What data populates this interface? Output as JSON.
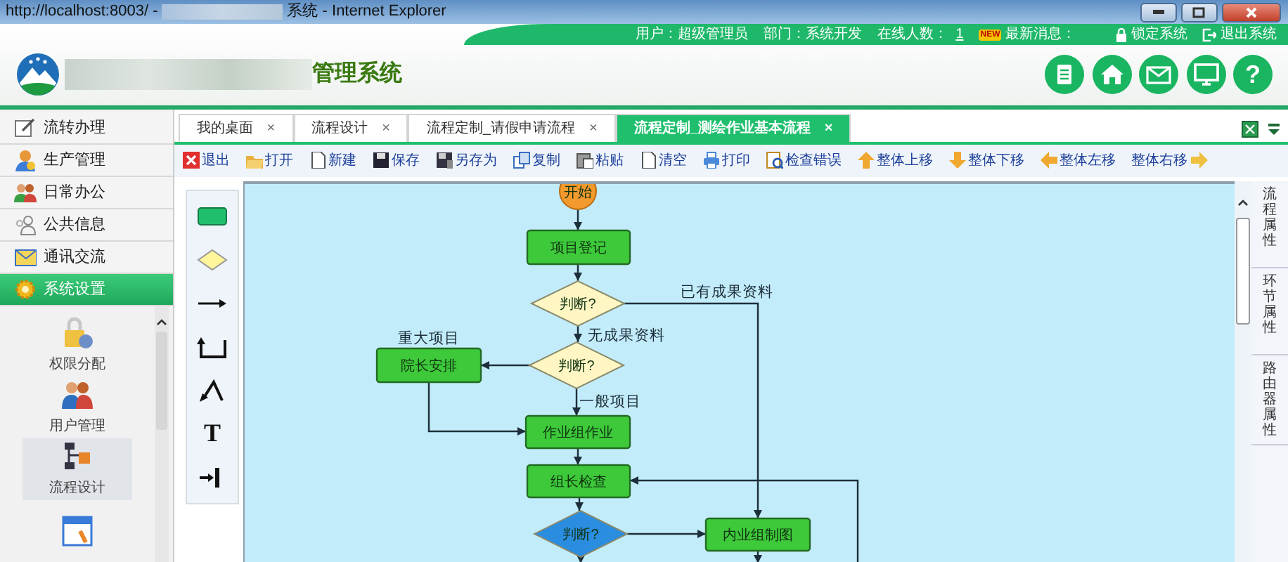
{
  "window": {
    "title_parts": [
      "http://localhost:8003/ -",
      "系统 - Internet Explorer"
    ]
  },
  "header": {
    "app_title": "管理系统",
    "user": "用户：超级管理员",
    "department": "部门：系统开发",
    "online_label": "在线人数：",
    "online_count": "1",
    "new_badge": "NEW",
    "messages_label": "最新消息：",
    "lock": "锁定系统",
    "logout": "退出系统",
    "buttons": [
      {
        "kind": "document"
      },
      {
        "kind": "home"
      },
      {
        "kind": "mail"
      },
      {
        "kind": "monitor"
      },
      {
        "kind": "help",
        "glyph": "?"
      }
    ]
  },
  "sidebar": {
    "menu": [
      {
        "label": "流转办理",
        "kind": "edit",
        "selected": false
      },
      {
        "label": "生产管理",
        "kind": "worker",
        "selected": false
      },
      {
        "label": "日常办公",
        "kind": "users",
        "selected": false
      },
      {
        "label": "公共信息",
        "kind": "person",
        "selected": false
      },
      {
        "label": "通讯交流",
        "kind": "mail",
        "selected": false
      },
      {
        "label": "系统设置",
        "kind": "gear",
        "selected": true
      }
    ],
    "subitems": [
      {
        "label": "权限分配",
        "kind": "lock",
        "selected": false
      },
      {
        "label": "用户管理",
        "kind": "users",
        "selected": false
      },
      {
        "label": "流程设计",
        "kind": "flow",
        "selected": true
      },
      {
        "kind": "form",
        "selected": false
      }
    ]
  },
  "tabs": [
    {
      "label": "我的桌面",
      "close": "×",
      "selected": false
    },
    {
      "label": "流程设计",
      "close": "×",
      "selected": false
    },
    {
      "label": "流程定制_请假申请流程",
      "close": "×",
      "selected": false
    },
    {
      "label": "流程定制_测绘作业基本流程",
      "close": "×",
      "selected": true
    }
  ],
  "toolbar": [
    {
      "label": "退出",
      "kind": "exit"
    },
    {
      "label": "打开",
      "kind": "open"
    },
    {
      "label": "新建",
      "kind": "new"
    },
    {
      "label": "保存",
      "kind": "save"
    },
    {
      "label": "另存为",
      "kind": "saveas"
    },
    {
      "label": "复制",
      "kind": "copy"
    },
    {
      "label": "粘贴",
      "kind": "paste"
    },
    {
      "label": "清空",
      "kind": "new"
    },
    {
      "label": "打印",
      "kind": "print"
    },
    {
      "label": "检查错误",
      "kind": "check"
    },
    {
      "label": "整体上移",
      "kind": "up"
    },
    {
      "label": "整体下移",
      "kind": "down"
    },
    {
      "label": "整体左移",
      "kind": "left"
    },
    {
      "label": "整体右移",
      "kind": "right"
    }
  ],
  "palette": [
    {
      "kind": "rect"
    },
    {
      "kind": "diamond"
    },
    {
      "kind": "arrow"
    },
    {
      "kind": "elbow"
    },
    {
      "kind": "polyline"
    },
    {
      "kind": "text",
      "glyph": "T"
    },
    {
      "kind": "end"
    }
  ],
  "diagram": {
    "nodes": [
      {
        "kind": "start",
        "label": "开始"
      },
      {
        "kind": "process",
        "label": "项目登记"
      },
      {
        "kind": "decision",
        "label": "判断?",
        "color": "#fff6c4"
      },
      {
        "kind": "decision",
        "label": "判断?",
        "color": "#fff6c4"
      },
      {
        "kind": "process",
        "label": "院长安排"
      },
      {
        "kind": "process",
        "label": "作业组作业"
      },
      {
        "kind": "process",
        "label": "组长检查"
      },
      {
        "kind": "decision",
        "label": "判断?",
        "color": "#2a8de0"
      },
      {
        "kind": "process",
        "label": "内业组制图"
      }
    ],
    "edge_labels": [
      "已有成果资料",
      "无成果资料",
      "重大项目",
      "一般项目"
    ]
  },
  "property_tabs": [
    {
      "label": "流程属性"
    },
    {
      "label": "环节属性"
    },
    {
      "label": "路由器属性"
    }
  ]
}
